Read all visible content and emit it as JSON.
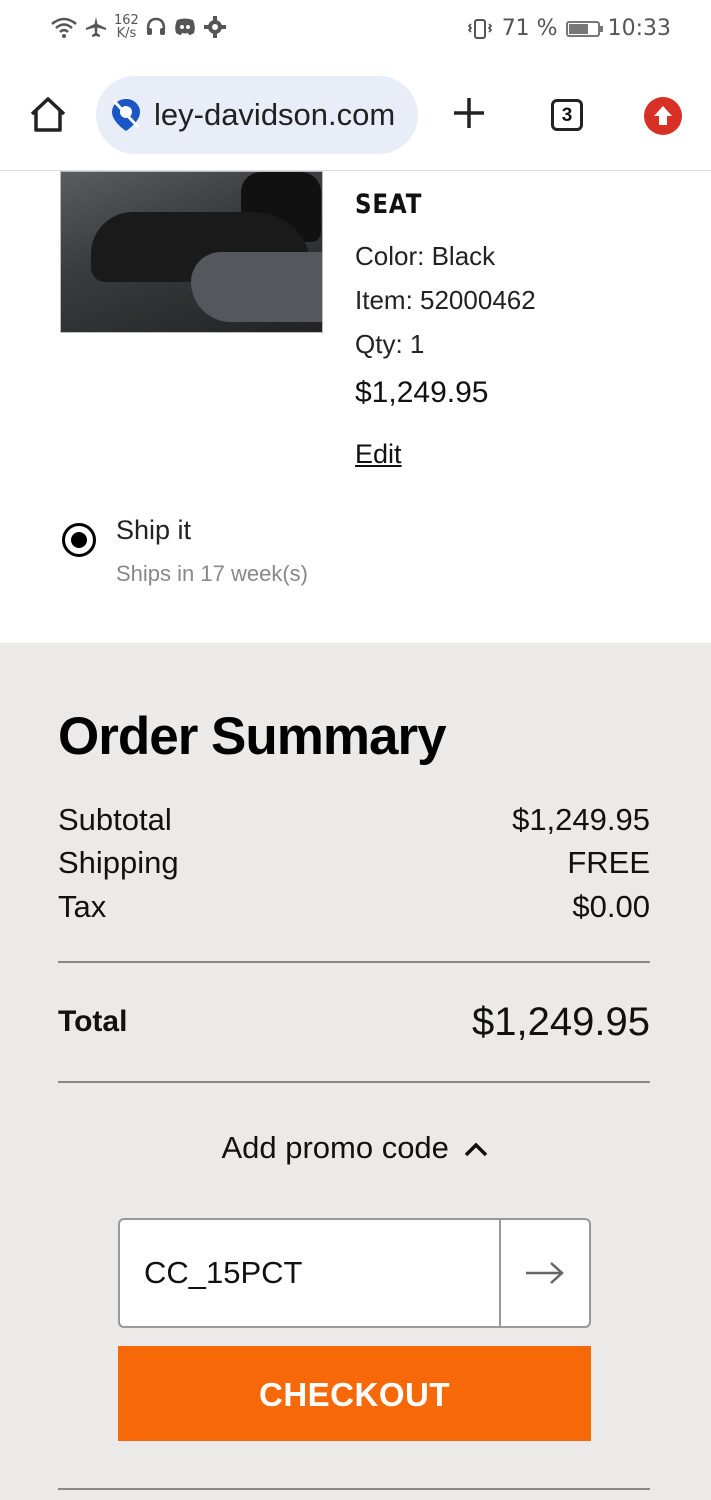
{
  "status_bar": {
    "net_speed_value": "162",
    "net_speed_unit": "K/s",
    "battery_percent": "71 %",
    "battery_level": 0.71,
    "time": "10:33",
    "icons": [
      "wifi-icon",
      "airplane-icon",
      "headset-icon",
      "discord-icon",
      "gear-icon",
      "vibrate-icon",
      "battery-icon"
    ]
  },
  "browser": {
    "url": "ley-davidson.com",
    "tab_count": "3",
    "accent_update_color": "#d93025"
  },
  "product": {
    "title": "SEAT",
    "color_line": "Color: Black",
    "item_line": "Item: 52000462",
    "qty_line": "Qty: 1",
    "price": "$1,249.95",
    "edit_label": "Edit",
    "shipping_option": {
      "label": "Ship it",
      "sublabel": "Ships in 17 week(s)",
      "selected": true
    }
  },
  "summary": {
    "title": "Order Summary",
    "rows": [
      {
        "label": "Subtotal",
        "value": "$1,249.95"
      },
      {
        "label": "Shipping",
        "value": "FREE"
      },
      {
        "label": "Tax",
        "value": "$0.00"
      }
    ],
    "total_label": "Total",
    "total_value": "$1,249.95",
    "promo_toggle_label": "Add promo code",
    "promo_code_value": "CC_15PCT",
    "checkout_label": "CHECKOUT",
    "checkout_color": "#f76808"
  }
}
